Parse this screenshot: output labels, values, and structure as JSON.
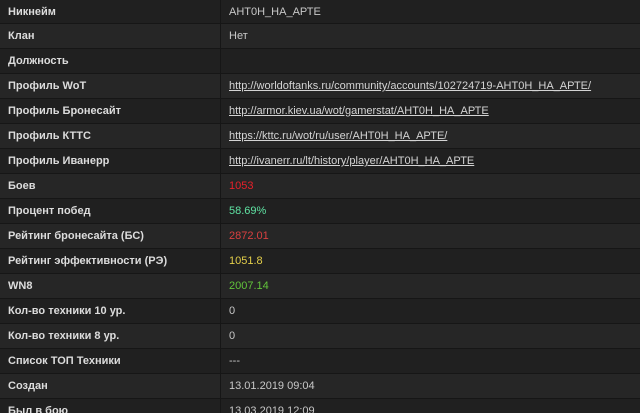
{
  "colors": {
    "red": "#e8202a",
    "green": "#5fe3a3",
    "yellow": "#e4cf4a",
    "lime": "#62c43b",
    "dark_red": "#d94040"
  },
  "rows": {
    "nickname": {
      "label": "Никнейм",
      "value": "АНТ0Н_НА_АРТЕ"
    },
    "clan": {
      "label": "Клан",
      "value": "Нет"
    },
    "position": {
      "label": "Должность",
      "value": ""
    },
    "wot_profile": {
      "label": "Профиль WoT",
      "value": "http://worldoftanks.ru/community/accounts/102724719-АНТ0Н_НА_АРТЕ/"
    },
    "armor_profile": {
      "label": "Профиль Бронесайт",
      "value": "http://armor.kiev.ua/wot/gamerstat/АНТ0Н_НА_АРТЕ"
    },
    "kttc_profile": {
      "label": "Профиль КТТС",
      "value": "https://kttc.ru/wot/ru/user/АНТ0Н_НА_АРТЕ/"
    },
    "ivanerr_profile": {
      "label": "Профиль Иванерр",
      "value": "http://ivanerr.ru/lt/history/player/АНТ0Н_НА_АРТЕ"
    },
    "battles": {
      "label": "Боев",
      "value": "1053"
    },
    "win_rate": {
      "label": "Процент побед",
      "value": "58.69%"
    },
    "armor_rating": {
      "label": "Рейтинг бронесайта (БС)",
      "value": "2872.01"
    },
    "efficiency_rating": {
      "label": "Рейтинг эффективности (РЭ)",
      "value": "1051.8"
    },
    "wn8": {
      "label": "WN8",
      "value": "2007.14"
    },
    "tier10_count": {
      "label": "Кол-во техники 10 ур.",
      "value": "0"
    },
    "tier8_count": {
      "label": "Кол-во техники 8 ур.",
      "value": "0"
    },
    "top_tanks": {
      "label": "Список ТОП Техники",
      "value": "---"
    },
    "created": {
      "label": "Создан",
      "value": "13.01.2019 09:04"
    },
    "last_battle": {
      "label": "Был в бою",
      "value": "13.03.2019 12:09"
    }
  }
}
